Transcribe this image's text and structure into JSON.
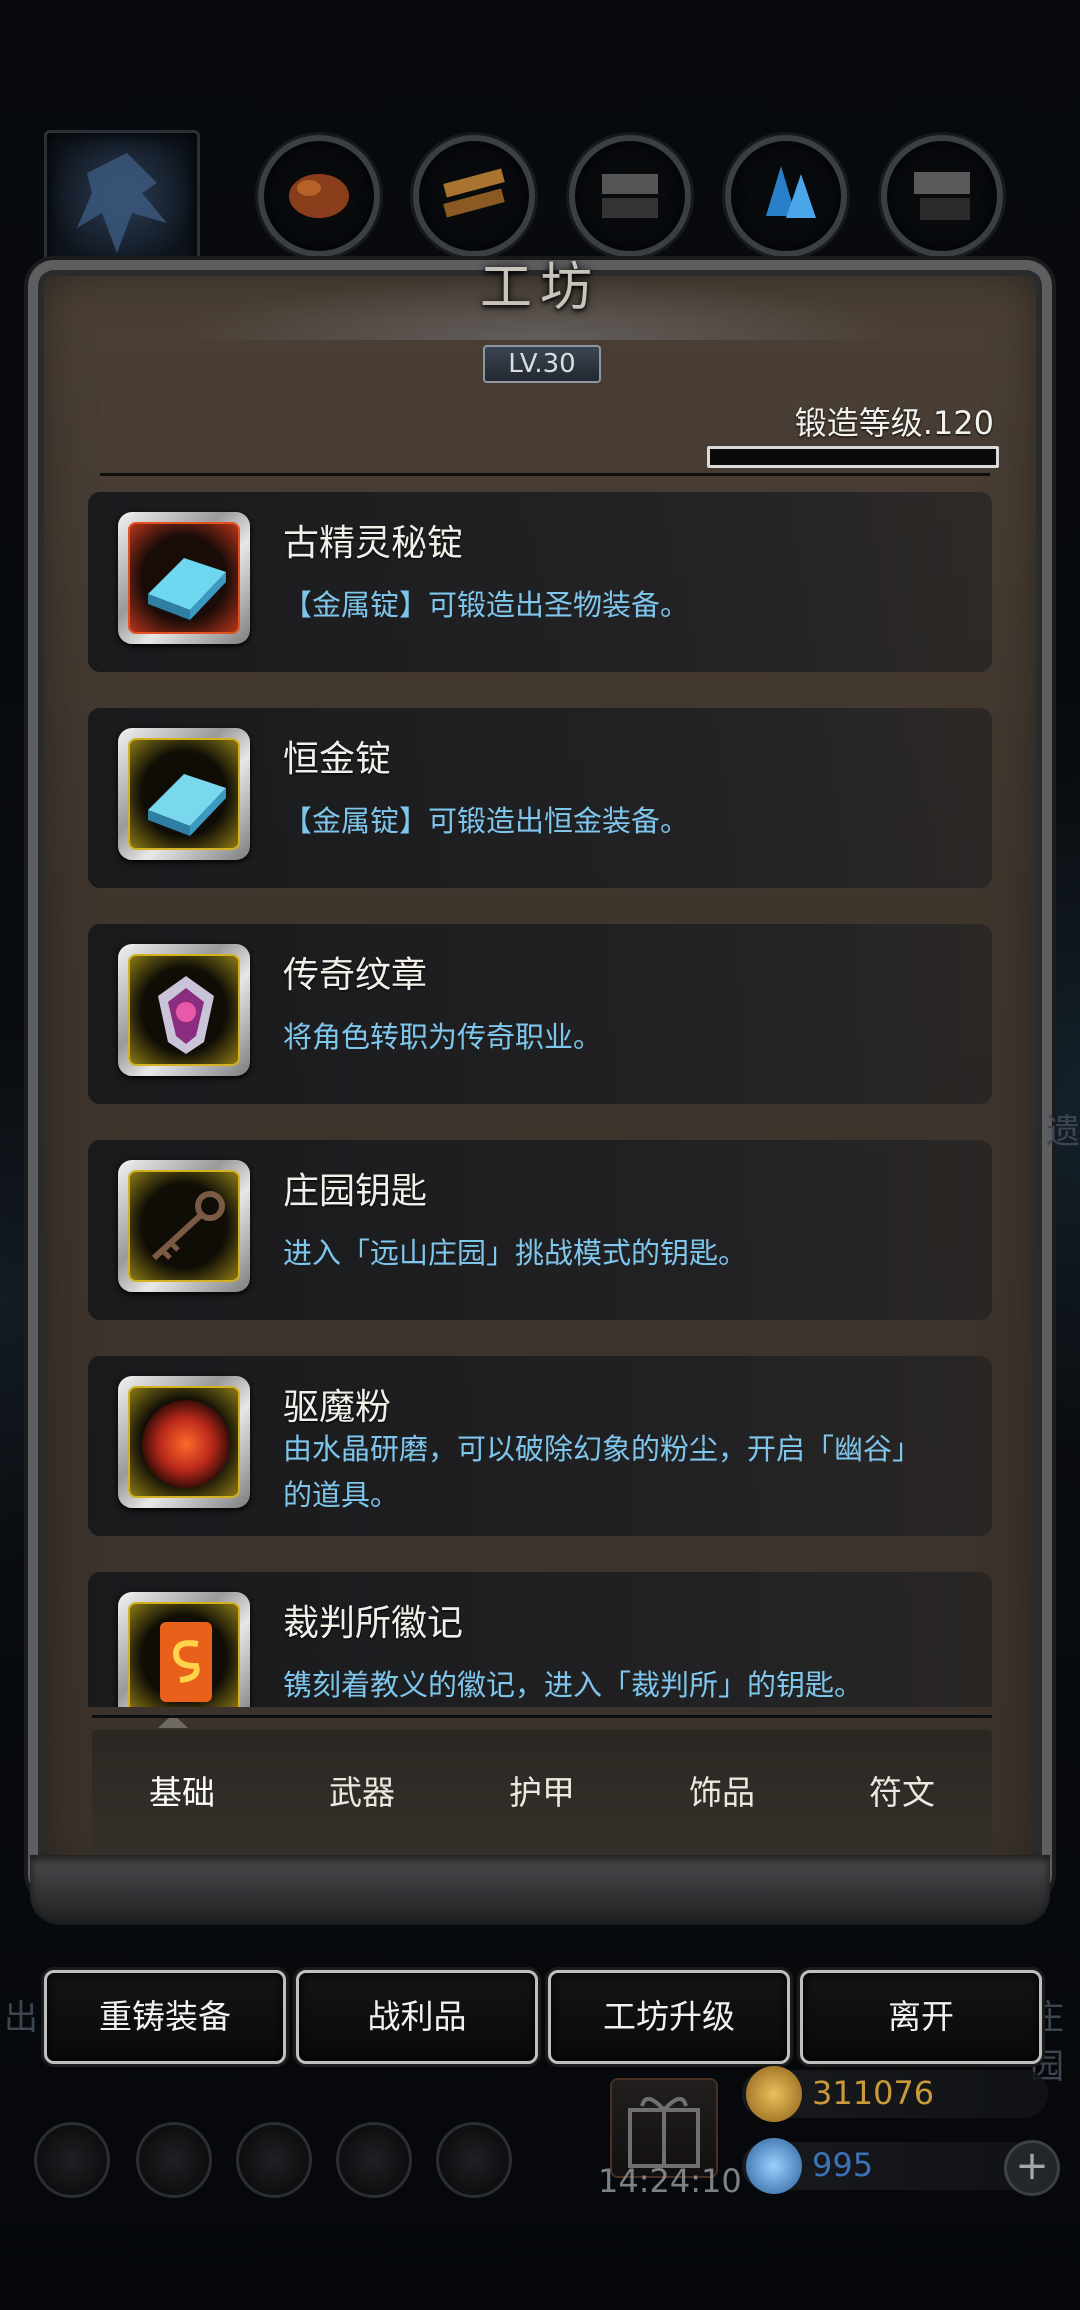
{
  "title": "工坊",
  "level": "LV.30",
  "forge": {
    "label": "锻造等级.120",
    "progress": 0
  },
  "items": [
    {
      "name": "古精灵秘锭",
      "desc": "【金属锭】可锻造出圣物装备。",
      "icon": "blue-ingot-icon",
      "frame": "red"
    },
    {
      "name": "恒金锭",
      "desc": "【金属锭】可锻造出恒金装备。",
      "icon": "blue-ingot-icon",
      "frame": "gold"
    },
    {
      "name": "传奇纹章",
      "desc": "将角色转职为传奇职业。",
      "icon": "crest-icon",
      "frame": "gold"
    },
    {
      "name": "庄园钥匙",
      "desc": "进入「远山庄园」挑战模式的钥匙。",
      "icon": "key-icon",
      "frame": "gold"
    },
    {
      "name": "驱魔粉",
      "desc": "由水晶研磨，可以破除幻象的粉尘，开启「幽谷」的道具。",
      "icon": "powder-icon",
      "frame": "gold"
    },
    {
      "name": "裁判所徽记",
      "desc": "镌刻着教义的徽记，进入「裁判所」的钥匙。",
      "icon": "emblem-icon",
      "frame": "gold"
    }
  ],
  "tabs": [
    "基础",
    "武器",
    "护甲",
    "饰品",
    "符文"
  ],
  "active_tab": "基础",
  "actions": [
    "重铸装备",
    "战利品",
    "工坊升级",
    "离开"
  ],
  "side_left": "出",
  "side_right": "庄园",
  "side_right_top": "遗",
  "timer": "14:24:10",
  "gold": "311076",
  "gems": "995",
  "plus": "+"
}
